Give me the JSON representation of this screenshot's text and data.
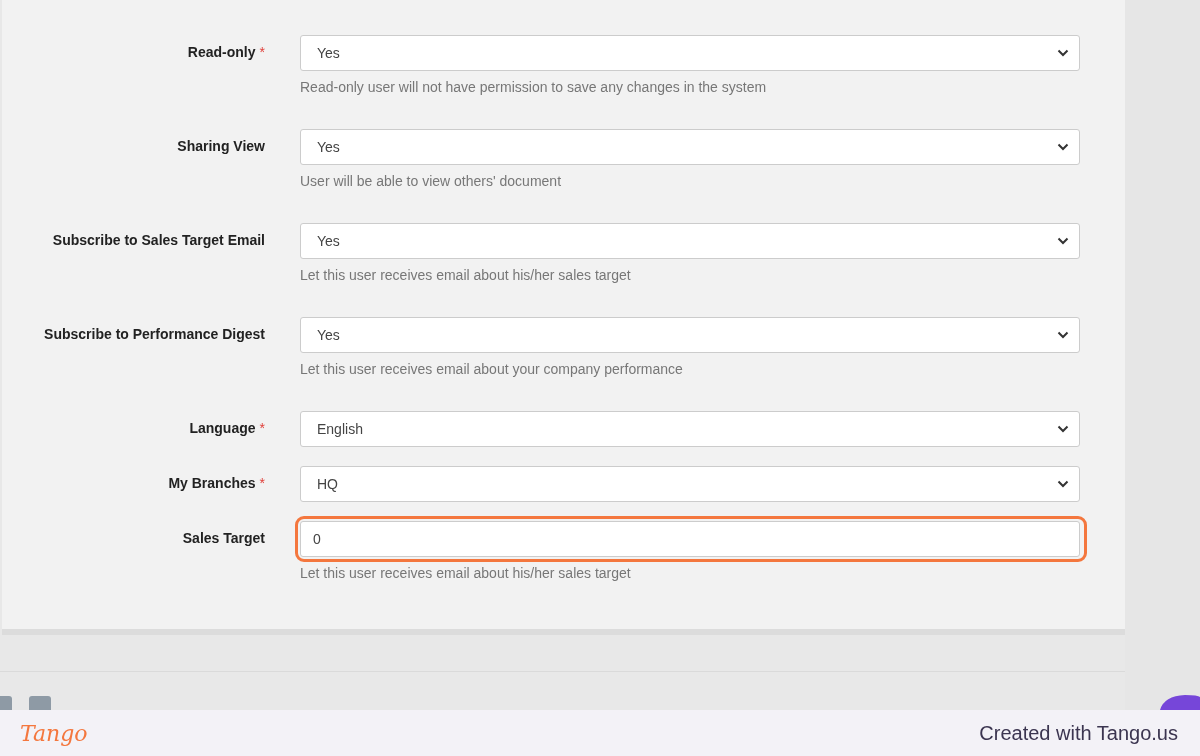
{
  "fields": [
    {
      "kind": "select",
      "label": "Read-only",
      "required_mark": "*",
      "value": "Yes",
      "help": "Read-only user will not have permission to save any changes in the system",
      "highlighted": false
    },
    {
      "kind": "select",
      "label": "Sharing View",
      "value": "Yes",
      "help": "User will be able to view others' document",
      "highlighted": false
    },
    {
      "kind": "select",
      "label": "Subscribe to Sales Target Email",
      "value": "Yes",
      "help": "Let this user receives email about his/her sales target",
      "highlighted": false
    },
    {
      "kind": "select",
      "label": "Subscribe to Performance Digest",
      "value": "Yes",
      "help": "Let this user receives email about your company performance",
      "highlighted": false
    },
    {
      "kind": "select",
      "label": "Language",
      "required_mark": "*",
      "value": "English",
      "highlighted": false
    },
    {
      "kind": "select",
      "label": "My Branches",
      "required_mark": "*",
      "value": "HQ",
      "highlighted": false
    },
    {
      "kind": "input",
      "label": "Sales Target",
      "value": "0",
      "help": "Let this user receives email about his/her sales target",
      "highlighted": true
    }
  ],
  "tango_bar": {
    "logo": "Tango",
    "credit": "Created with Tango.us"
  }
}
